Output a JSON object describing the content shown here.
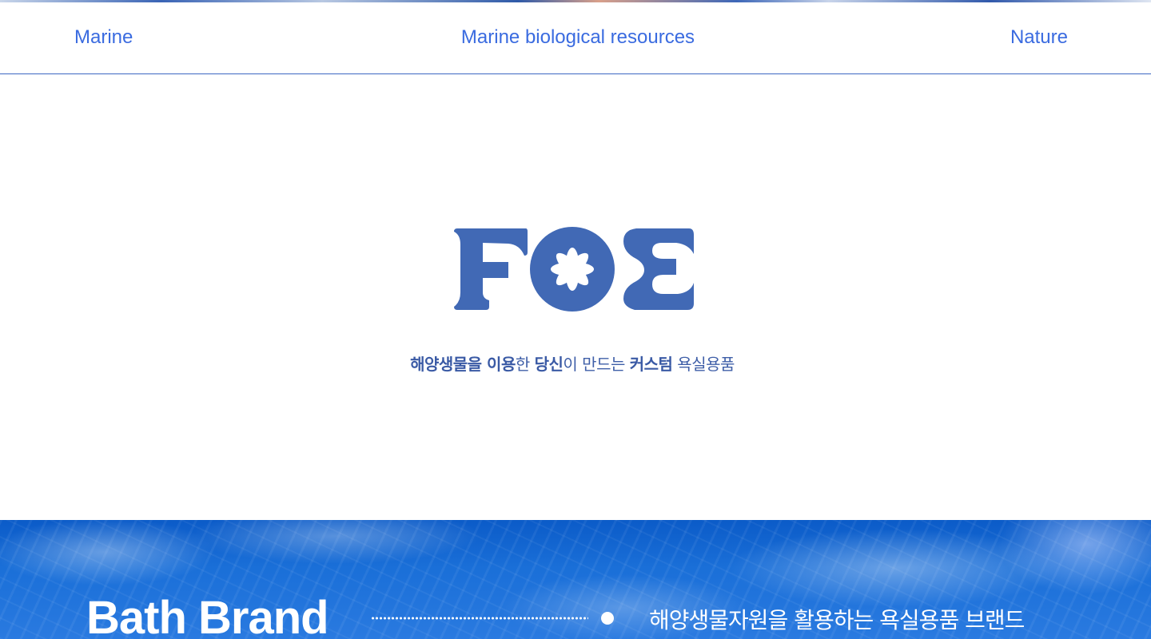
{
  "nav": {
    "left": "Marine",
    "center": "Marine biological resources",
    "right": "Nature"
  },
  "logo": {
    "text": "FOE",
    "color": "#4169b5"
  },
  "tagline": {
    "part1_bold": "해양생물을 이용",
    "part2": "한 ",
    "part3_bold": "당신",
    "part4": "이 만드는 ",
    "part5_bold": "커스텀",
    "part6": " 욕실용품"
  },
  "banner": {
    "title": "Bath Brand",
    "description": "해양생물자원을 활용하는 욕실용품 브랜드"
  },
  "colors": {
    "accent": "#3a6be0",
    "logo": "#4169b5",
    "ocean": "#1a6fd8"
  }
}
